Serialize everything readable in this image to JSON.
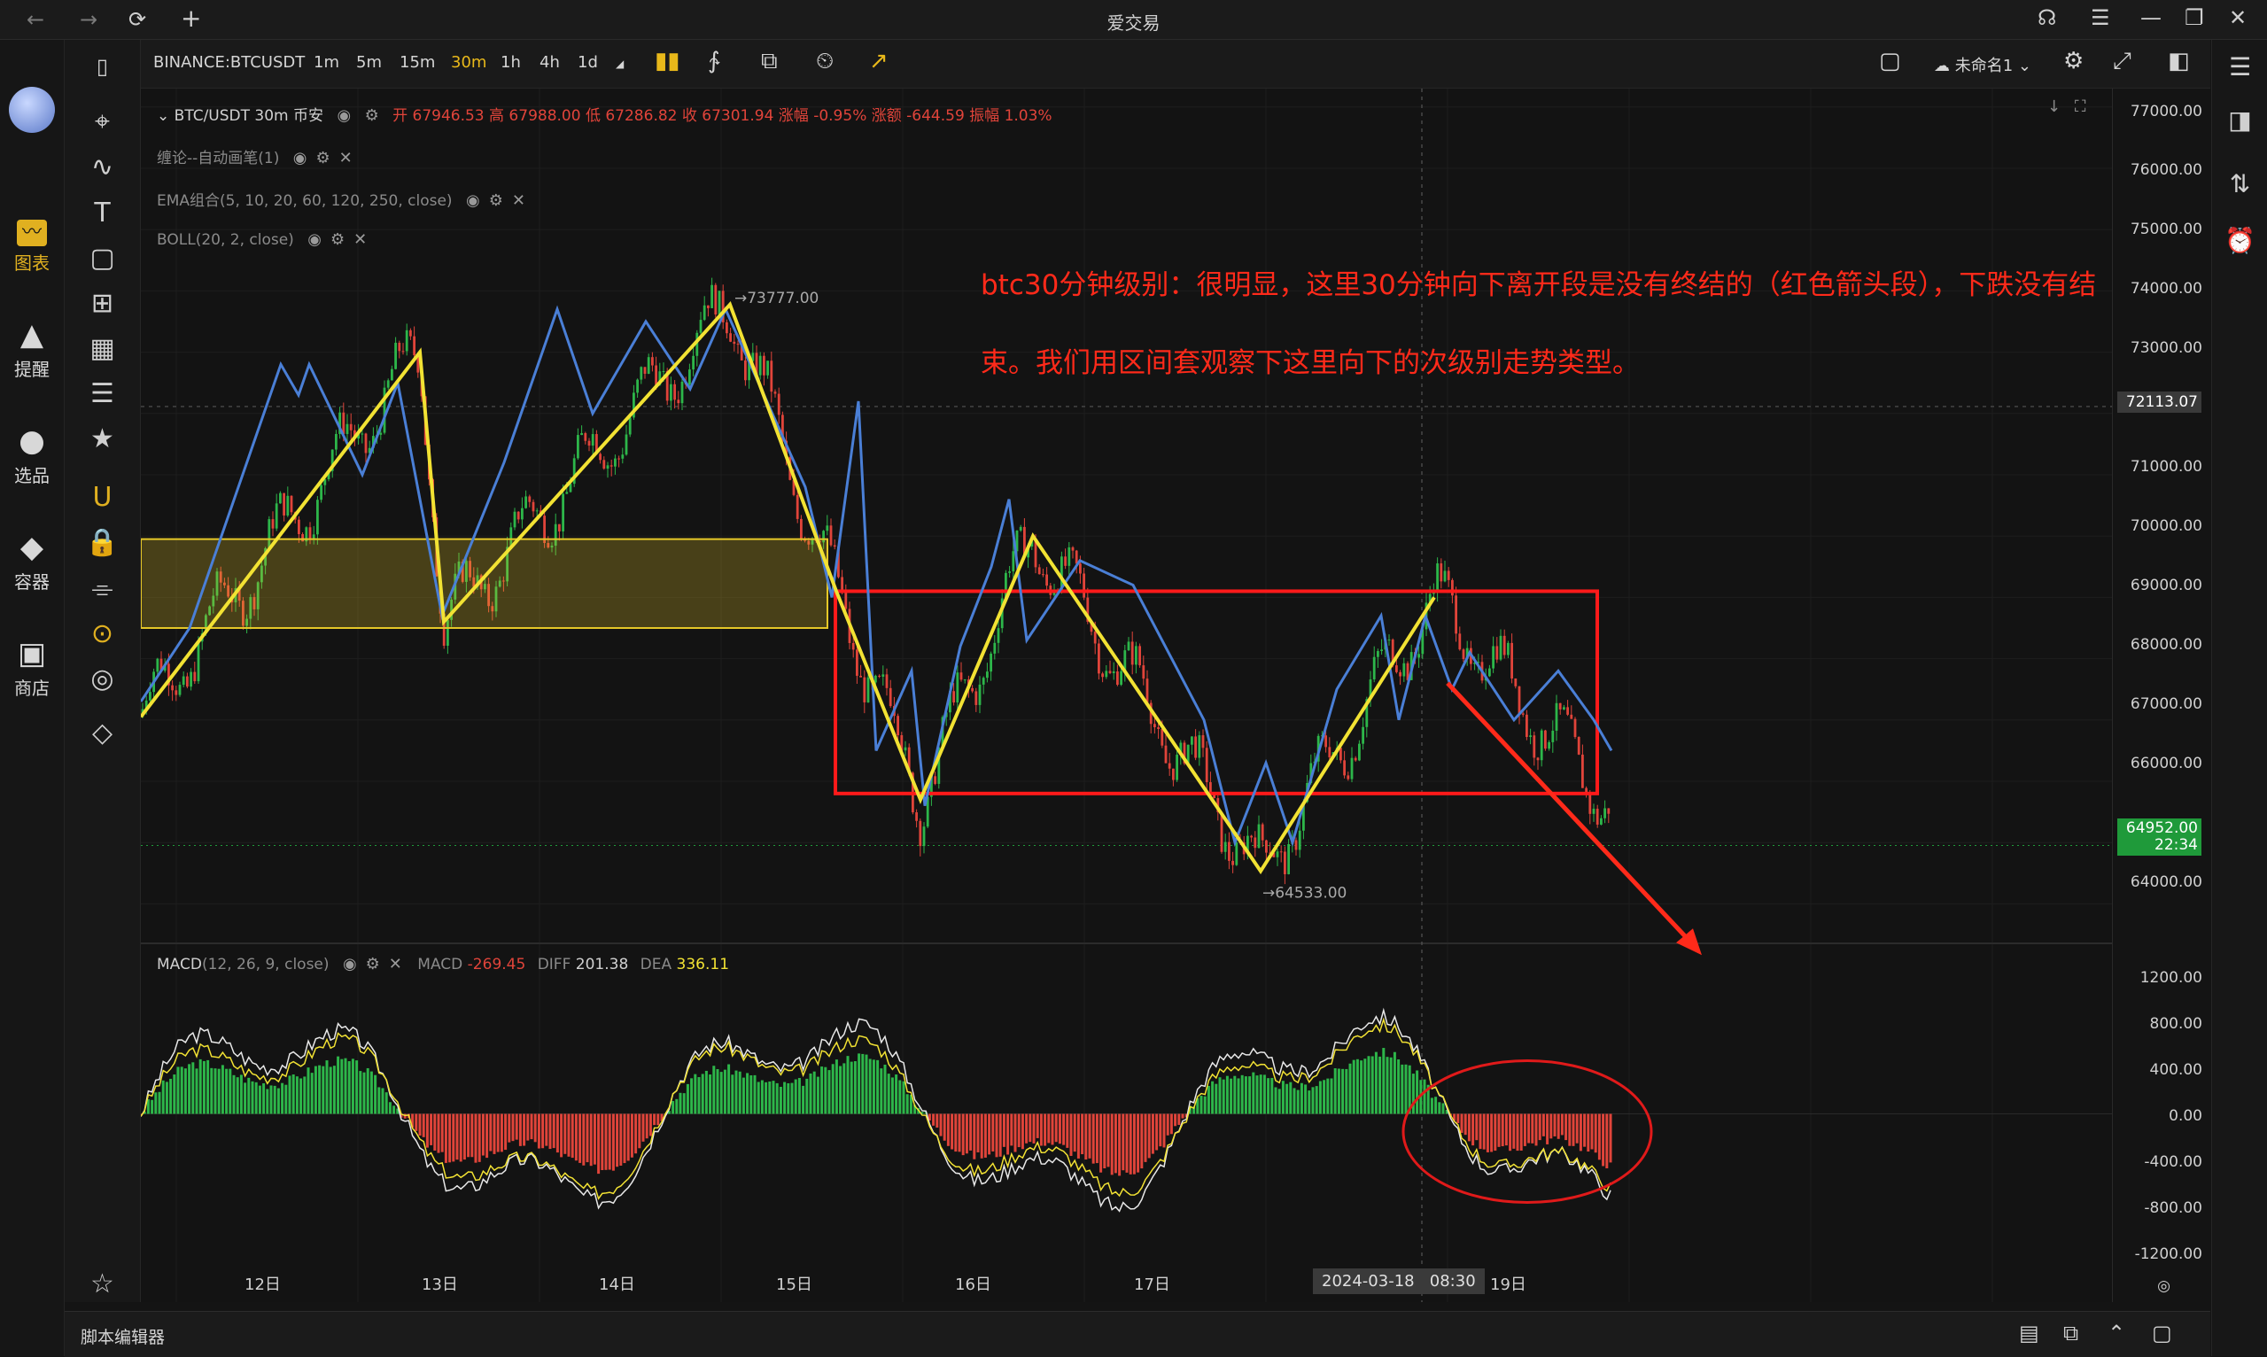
{
  "window": {
    "title": "爱交易",
    "nav_back": "←",
    "nav_forward": "→",
    "reload": "⟳",
    "new_tab": "+",
    "controls": [
      "☊",
      "☰",
      "—",
      "❐",
      "✕"
    ]
  },
  "sidebar": {
    "items": [
      {
        "label": "图表",
        "icon": "chart-icon",
        "glyph": "📈"
      },
      {
        "label": "提醒",
        "icon": "bell-icon",
        "glyph": "🔔"
      },
      {
        "label": "选品",
        "icon": "screener-icon",
        "glyph": "◉"
      },
      {
        "label": "容器",
        "icon": "container-icon",
        "glyph": "◆"
      },
      {
        "label": "商店",
        "icon": "store-icon",
        "glyph": "▣"
      }
    ]
  },
  "tools": {
    "items": [
      {
        "icon": "cursor-icon",
        "glyph": "⌖"
      },
      {
        "icon": "trendline-icon",
        "glyph": "∿"
      },
      {
        "icon": "text-icon",
        "glyph": "T"
      },
      {
        "icon": "rectangle-icon",
        "glyph": "▢"
      },
      {
        "icon": "pattern-icon",
        "glyph": "⊞"
      },
      {
        "icon": "grid-icon",
        "glyph": "▦"
      },
      {
        "icon": "list-icon",
        "glyph": "☰"
      },
      {
        "icon": "star-icon",
        "glyph": "★"
      },
      {
        "icon": "magnet-icon",
        "glyph": "U"
      },
      {
        "icon": "lock-icon",
        "glyph": "🔒"
      },
      {
        "icon": "filter-icon",
        "glyph": "⌯"
      },
      {
        "icon": "crosshair-icon",
        "glyph": "⊙"
      },
      {
        "icon": "eye-off-icon",
        "glyph": "◎"
      },
      {
        "icon": "eraser-icon",
        "glyph": "◇"
      }
    ],
    "favorite": {
      "icon": "favorite-star-icon",
      "glyph": "☆"
    }
  },
  "toolbar": {
    "symbol": "BINANCE:BTCUSDT",
    "intervals": [
      "1m",
      "5m",
      "15m",
      "30m",
      "1h",
      "4h",
      "1d"
    ],
    "active_interval": "30m",
    "layout_name": "未命名1",
    "colors": {
      "active": "#e8b81a"
    }
  },
  "legend": {
    "main": {
      "symbol": "BTC/USDT",
      "interval": "30m",
      "exchange": "币安",
      "ohlc": "开 67946.53  高 67988.00  低 67286.82  收 67301.94  涨幅 -0.95%  涨额 -644.59  振幅 1.03%"
    },
    "indicators": [
      {
        "name": "缠论--自动画笔",
        "params": "(1)"
      },
      {
        "name": "EMA组合",
        "params": "(5, 10, 20, 60, 120, 250, close)"
      },
      {
        "name": "BOLL",
        "params": "(20, 2, close)"
      }
    ],
    "macd": {
      "name": "MACD",
      "params": "(12, 26, 9, close)",
      "macd_label": "MACD",
      "macd_value": "-269.45",
      "diff_label": "DIFF",
      "diff_value": "201.38",
      "dea_label": "DEA",
      "dea_value": "336.11"
    }
  },
  "annotation": {
    "text": "btc30分钟级别：很明显，这里30分钟向下离开段是没有终结的（红色箭头段），下跌没有结束。我们用区间套观察下这里向下的次级别走势类型。",
    "high_label": "73777.00",
    "low_label": "64533.00"
  },
  "price_axis": {
    "labels": [
      "77000.00",
      "76000.00",
      "75000.00",
      "74000.00",
      "73000.00",
      "71000.00",
      "70000.00",
      "69000.00",
      "68000.00",
      "67000.00",
      "66000.00",
      "64000.00"
    ],
    "crosshair_price": "72113.07",
    "last_price": "64952.00",
    "countdown": "22:34",
    "macd_labels": [
      "1200.00",
      "800.00",
      "400.00",
      "0.00",
      "-400.00",
      "-800.00",
      "-1200.00"
    ]
  },
  "time_axis": {
    "labels": [
      "12日",
      "13日",
      "14日",
      "15日",
      "16日",
      "17日",
      "19日"
    ],
    "crosshair_time": "2024-03-18   08:30"
  },
  "bottom": {
    "script_editor": "脚本编辑器"
  },
  "chart_data": {
    "type": "line",
    "title": "",
    "symbol": "BTC/USDT",
    "interval": "30m",
    "price_range": [
      63500,
      77300
    ],
    "pen_strokes_yellow": [
      {
        "point": "start",
        "price": 67050
      },
      {
        "point": "12日 high",
        "price": 73000
      },
      {
        "point": "13日 low",
        "price": 68600
      },
      {
        "point": "14日 high",
        "price": 73777
      },
      {
        "point": "15日 mid",
        "price": 69100
      },
      {
        "point": "15日 low",
        "price": 65700
      },
      {
        "point": "16日 high",
        "price": 70000
      },
      {
        "point": "17日 low",
        "price": 64533
      },
      {
        "point": "18日 high",
        "price": 69000
      }
    ],
    "pivot_zones": [
      {
        "color": "yellow",
        "price_low": 68500,
        "price_high": 69950
      },
      {
        "color": "red",
        "price_low": 65800,
        "price_high": 69100
      }
    ],
    "macd": {
      "range": [
        -1300,
        1300
      ],
      "last": {
        "macd": -269.45,
        "diff": 201.38,
        "dea": 336.11
      }
    },
    "colors": {
      "up": "#2db64a",
      "down": "#e0443a",
      "pen": "#f2e233",
      "segment": "#4a7fd6",
      "annotation": "#ff2a1a"
    }
  }
}
